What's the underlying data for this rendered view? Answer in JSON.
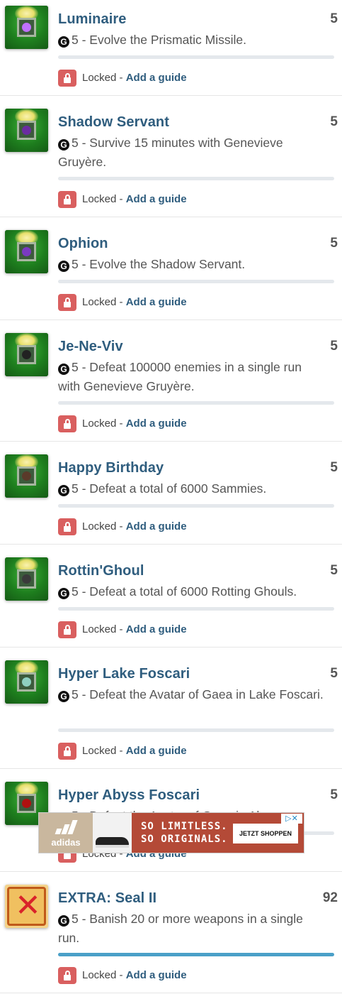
{
  "items": [
    {
      "title": "Luminaire",
      "score": "5",
      "g": "G",
      "desc": "5 - Evolve the Prismatic Missile.",
      "locked": "Locked",
      "sep": " - ",
      "guide": "Add a guide"
    },
    {
      "title": "Shadow Servant",
      "score": "5",
      "g": "G",
      "desc": "5 - Survive 15 minutes with Genevieve Gruyère.",
      "locked": "Locked",
      "sep": " - ",
      "guide": "Add a guide"
    },
    {
      "title": "Ophion",
      "score": "5",
      "g": "G",
      "desc": "5 - Evolve the Shadow Servant.",
      "locked": "Locked",
      "sep": " - ",
      "guide": "Add a guide"
    },
    {
      "title": "Je-Ne-Viv",
      "score": "5",
      "g": "G",
      "desc": "5 - Defeat 100000 enemies in a single run with Genevieve Gruyère.",
      "locked": "Locked",
      "sep": " - ",
      "guide": "Add a guide"
    },
    {
      "title": "Happy Birthday",
      "score": "5",
      "g": "G",
      "desc": "5 - Defeat a total of 6000 Sammies.",
      "locked": "Locked",
      "sep": " - ",
      "guide": "Add a guide"
    },
    {
      "title": "Rottin'Ghoul",
      "score": "5",
      "g": "G",
      "desc": "5 - Defeat a total of 6000 Rotting Ghouls.",
      "locked": "Locked",
      "sep": " - ",
      "guide": "Add a guide"
    },
    {
      "title": "Hyper Lake Foscari",
      "score": "5",
      "g": "G",
      "desc": "5 - Defeat the Avatar of Gaea in Lake Foscari.",
      "locked": "Locked",
      "sep": " - ",
      "guide": "Add a guide"
    },
    {
      "title": "Hyper Abyss Foscari",
      "score": "5",
      "g": "G",
      "desc": "5 - Defeat the Avatar of Gaea in Abyss Foscari.",
      "locked": "Locked",
      "sep": " - ",
      "guide": "Add a guide"
    },
    {
      "title": "EXTRA: Seal II",
      "score": "92",
      "g": "G",
      "desc": "5 - Banish 20 or more weapons in a single run.",
      "locked": "Locked",
      "sep": " - ",
      "guide": "Add a guide"
    }
  ],
  "progress": [
    0.0,
    0.0,
    0.0,
    0.0,
    0.0,
    0.0,
    0.0,
    0.0,
    1.0
  ],
  "icons": [
    "prismatic-missile-icon",
    "shadow-servant-icon",
    "ophion-icon",
    "je-ne-viv-icon",
    "happy-birthday-icon",
    "rottin-ghoul-icon",
    "hyper-lake-icon",
    "hyper-abyss-icon",
    "seal-icon"
  ],
  "gem_colors": [
    "#c070ff",
    "#6a2ca0",
    "#7a3ac0",
    "#222222",
    "#5a3a2a",
    "#3a3a3a",
    "#8fd0c0",
    "#b01010",
    "#d9232a"
  ],
  "ad": {
    "brand": "adidas",
    "slogan_1": "SO LIMITLESS.",
    "slogan_2": "SO ORIGINALS.",
    "cta": "JETZT SHOPPEN",
    "adchoice": "▷✕"
  },
  "colors": {
    "title": "#2f5d7e",
    "lock": "#d95f5f",
    "progress_fill": "#4aa0c8"
  }
}
